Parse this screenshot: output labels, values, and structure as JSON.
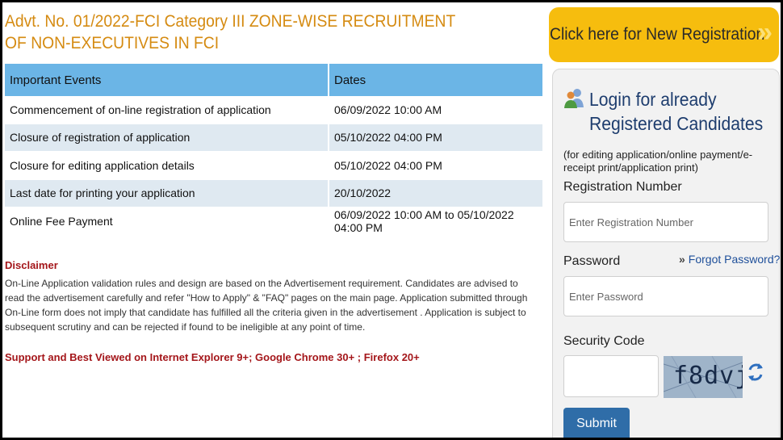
{
  "header": {
    "title": "Advt. No. 01/2022-FCI Category III ZONE-WISE RECRUITMENT OF NON-EXECUTIVES IN FCI"
  },
  "events_table": {
    "headers": [
      "Important Events",
      "Dates"
    ],
    "rows": [
      {
        "event": "Commencement of on-line registration of application",
        "date": "06/09/2022 10:00 AM"
      },
      {
        "event": "Closure of registration of application",
        "date": "05/10/2022 04:00 PM"
      },
      {
        "event": "Closure for editing application details",
        "date": "05/10/2022 04:00 PM"
      },
      {
        "event": "Last date for printing your application",
        "date": "20/10/2022"
      },
      {
        "event": "Online Fee Payment",
        "date": "06/09/2022 10:00 AM to 05/10/2022 04:00 PM"
      }
    ]
  },
  "disclaimer": {
    "title": "Disclaimer",
    "text": "On-Line Application validation rules and design are based on the Advertisement requirement. Candidates are advised to read the advertisement carefully and refer \"How to Apply\" & \"FAQ\" pages on the main page. Application submitted through On-Line form does not imply that candidate has fulfilled all the criteria given in the advertisement . Application is subject to subsequent scrutiny and can be rejected if found to be ineligible at any point of time.",
    "support": "Support and Best Viewed on Internet Explorer 9+; Google Chrome 30+ ; Firefox 20+"
  },
  "new_registration": {
    "label": "Click here for New Registration",
    "icon": "double-chevron-right-icon"
  },
  "login": {
    "icon": "users-icon",
    "title_line1": "Login for already",
    "title_line2": "Registered Candidates",
    "note": "(for editing application/online payment/e-receipt print/application print)",
    "registration_label": "Registration Number",
    "registration_placeholder": "Enter Registration Number",
    "password_label": "Password",
    "forgot_label": "Forgot Password?",
    "password_placeholder": "Enter Password",
    "security_label": "Security Code",
    "captcha_text": "f8dvj",
    "refresh_icon": "refresh-icon",
    "submit_label": "Submit"
  },
  "colors": {
    "title": "#d58b12",
    "table_header": "#6bb5e6",
    "alt_row": "#dfe9f1",
    "disclaimer": "#a4161a",
    "new_reg_bg": "#f6bd0e",
    "login_title": "#1e3d6e",
    "submit_bg": "#2f6da8"
  }
}
